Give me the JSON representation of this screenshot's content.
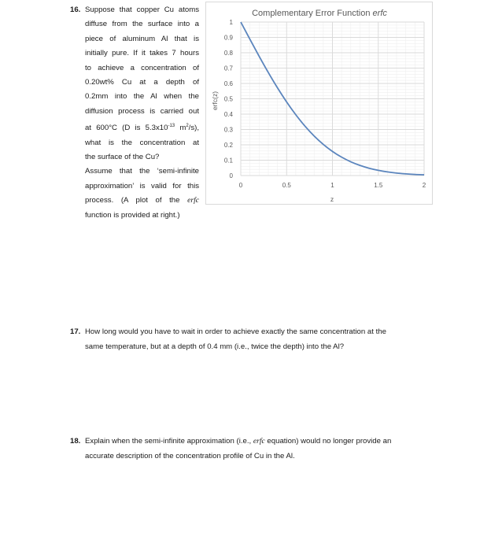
{
  "questions": {
    "q16": {
      "number": "16.",
      "lines": [
        "Suppose that copper Cu atoms",
        "diffuse from the surface into a",
        "piece of aluminum Al that is",
        "initially pure. If it takes 7 hours",
        "to achieve a concentration of",
        "0.20wt% Cu at a depth of",
        "0.2mm into the Al when the",
        "diffusion process is carried out"
      ],
      "line9_pre": "at 600°C (D is 5.3x10",
      "line9_sup1": "-13",
      "line9_mid": " m",
      "line9_sup2": "2",
      "line9_post": "/s),",
      "lines_after": [
        "what is the concentration at",
        "the surface of the Cu?",
        "Assume that the ‘semi-infinite",
        "approximation’ is valid for this"
      ],
      "line14_pre": "process. (A plot of the ",
      "line14_italic": "erfc",
      "line15": "function is provided at right.)"
    },
    "q17": {
      "number": "17.",
      "line1": "How long would you have to wait in order to achieve exactly the same concentration at the",
      "line2": "same temperature, but at a depth of 0.4 mm (i.e., twice the depth) into the Al?"
    },
    "q18": {
      "number": "18.",
      "line1_pre": "Explain when the semi-infinite approximation (i.e., ",
      "line1_italic": "erfc",
      "line1_post": " equation) would no longer provide an",
      "line2": "accurate description of the concentration profile of Cu in the Al."
    }
  },
  "chart_data": {
    "type": "line",
    "title": "Complementary Error Function ",
    "title_italic": "erfc",
    "xlabel": "z",
    "ylabel": "erfc(z)",
    "xlim": [
      0,
      2
    ],
    "ylim": [
      0,
      1
    ],
    "x_ticks": [
      0,
      0.5,
      1,
      1.5,
      2
    ],
    "x_tick_labels": [
      "0",
      "0.5",
      "1",
      "1.5",
      "2"
    ],
    "y_ticks": [
      0,
      0.1,
      0.2,
      0.3,
      0.4,
      0.5,
      0.6,
      0.7,
      0.8,
      0.9,
      1
    ],
    "y_tick_labels": [
      "0",
      "0.1",
      "0.2",
      "0.3",
      "0.4",
      "0.5",
      "0.6",
      "0.7",
      "0.8",
      "0.9",
      "1"
    ],
    "grid": true,
    "minor_grid": true,
    "legend": "none",
    "series": [
      {
        "name": "erfc(z)",
        "color": "#5b85bd",
        "x": [
          0,
          0.1,
          0.2,
          0.3,
          0.4,
          0.5,
          0.6,
          0.7,
          0.8,
          0.9,
          1.0,
          1.1,
          1.2,
          1.3,
          1.4,
          1.5,
          1.6,
          1.7,
          1.8,
          1.9,
          2.0
        ],
        "y": [
          1.0,
          0.8875,
          0.7773,
          0.6714,
          0.5716,
          0.4795,
          0.3961,
          0.3222,
          0.2579,
          0.2031,
          0.1573,
          0.1198,
          0.0897,
          0.066,
          0.0477,
          0.0339,
          0.0237,
          0.0162,
          0.0109,
          0.0072,
          0.0047
        ]
      }
    ]
  },
  "colors": {
    "grid_major": "#d9d9d9",
    "grid_minor": "#efefef",
    "axis_text": "#595959"
  }
}
